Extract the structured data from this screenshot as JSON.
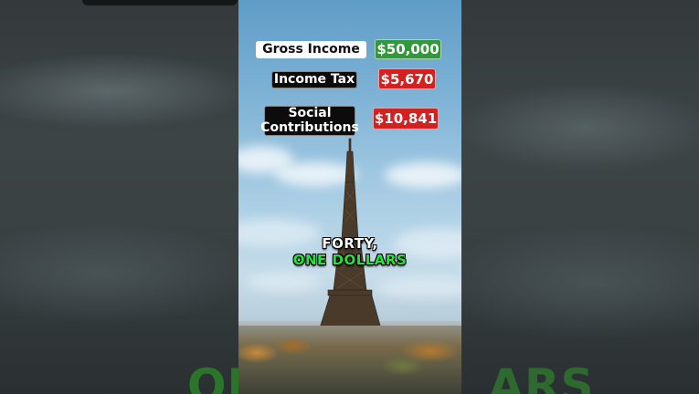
{
  "overlay": {
    "rows": [
      {
        "label": "Gross Income",
        "amount": "$50,000",
        "amount_color": "#2e9a3a",
        "label_style": "white"
      },
      {
        "label": "Income Tax",
        "amount": "$5,670",
        "amount_color": "#d61f1f",
        "label_style": "black"
      },
      {
        "label": "Social Contributions",
        "label_line1": "Social",
        "label_line2": "Contributions",
        "amount": "$10,841",
        "amount_color": "#d61f1f",
        "label_style": "black"
      }
    ]
  },
  "captions": {
    "line1": "FORTY,",
    "line2": "ONE DOLLARS",
    "line2_color": "#22e53a"
  },
  "background_text": {
    "left": "ON",
    "right": "ARS"
  },
  "scene": {
    "subject": "eiffel-tower",
    "sky_color": "#7fb3d6"
  }
}
